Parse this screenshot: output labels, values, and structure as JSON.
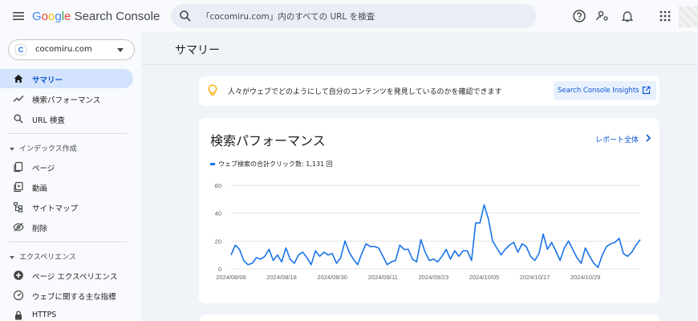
{
  "app": {
    "logo_google": "Google",
    "logo_product": "Search Console"
  },
  "search": {
    "placeholder": "「cocomiru.com」内のすべての URL を検査"
  },
  "property": {
    "favicon_letter": "C",
    "name": "cocomiru.com"
  },
  "sidebar": {
    "items_top": [
      {
        "label": "サマリー",
        "icon": "home-icon",
        "active": true
      },
      {
        "label": "検索パフォーマンス",
        "icon": "trending-up-icon"
      },
      {
        "label": "URL 検査",
        "icon": "search-icon"
      }
    ],
    "section_index": "インデックス作成",
    "items_index": [
      {
        "label": "ページ",
        "icon": "pages-icon"
      },
      {
        "label": "動画",
        "icon": "video-icon"
      },
      {
        "label": "サイトマップ",
        "icon": "sitemap-icon"
      },
      {
        "label": "削除",
        "icon": "removal-icon"
      }
    ],
    "section_experience": "エクスペリエンス",
    "items_experience": [
      {
        "label": "ページ エクスペリエンス",
        "icon": "page-experience-icon"
      },
      {
        "label": "ウェブに関する主な指標",
        "icon": "web-vitals-icon"
      },
      {
        "label": "HTTPS",
        "icon": "lock-icon"
      }
    ]
  },
  "main": {
    "title": "サマリー",
    "banner": {
      "text": "人々がウェブでどのようにして自分のコンテンツを発見しているのかを確認できます",
      "button": "Search Console Insights"
    },
    "performance": {
      "title": "検索パフォーマンス",
      "report_link": "レポート全体",
      "legend": "ウェブ検索の合計クリック数: 1,131 回"
    }
  },
  "colors": {
    "accent": "#1a73e8",
    "active_nav": "#d3e3fd",
    "link": "#0b57d0"
  },
  "chart_data": {
    "type": "line",
    "series": [
      {
        "name": "ウェブ検索の合計クリック数",
        "values": [
          10,
          17,
          14,
          6,
          3,
          4,
          8,
          7,
          9,
          14,
          6,
          10,
          5,
          15,
          7,
          4,
          10,
          12,
          8,
          3,
          13,
          9,
          12,
          10,
          11,
          4,
          8,
          20,
          12,
          7,
          3,
          11,
          18,
          16,
          16,
          15,
          9,
          3,
          5,
          6,
          17,
          14,
          14,
          7,
          5,
          21,
          12,
          6,
          7,
          5,
          9,
          14,
          7,
          13,
          9,
          13,
          13,
          6,
          33,
          33,
          46,
          36,
          20,
          15,
          10,
          14,
          17,
          19,
          12,
          18,
          16,
          9,
          6,
          11,
          25,
          14,
          19,
          13,
          6,
          15,
          20,
          14,
          8,
          4,
          15,
          9,
          4,
          1,
          10,
          16,
          18,
          19,
          22,
          11,
          9,
          12,
          17,
          21
        ]
      }
    ],
    "x_tick_labels": [
      "2024/08/06",
      "2024/08/18",
      "2024/08/30",
      "2024/09/11",
      "2024/09/23",
      "2024/10/05",
      "2024/10/17",
      "2024/10/29"
    ],
    "y_ticks": [
      0,
      20,
      40,
      60
    ],
    "ylim": [
      0,
      60
    ],
    "grid": true
  }
}
